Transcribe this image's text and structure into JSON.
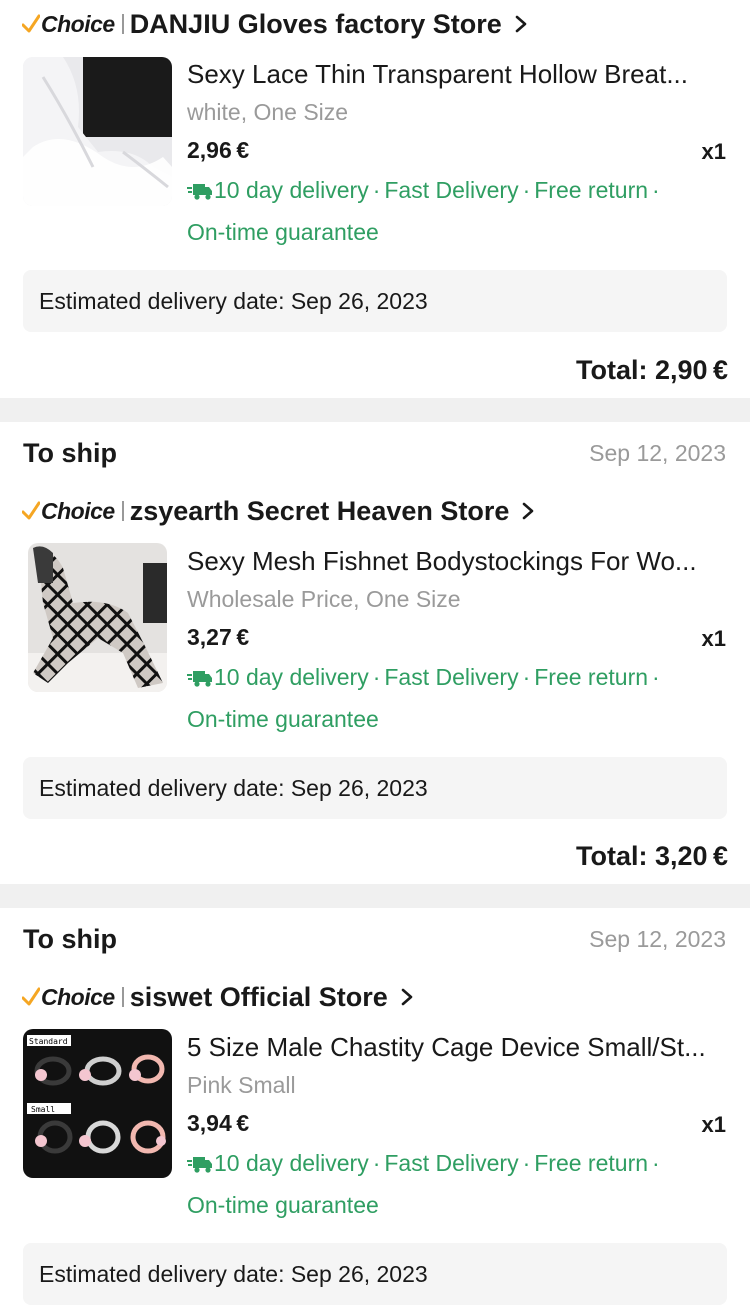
{
  "choice_label": "Choice",
  "colors": {
    "green": "#2f9e62",
    "choice_check": "#f5a623",
    "gap": "#f0f0f0"
  },
  "orders": [
    {
      "status": "",
      "date": "",
      "store": "DANJIU Gloves factory Store",
      "product_title": "Sexy Lace Thin Transparent Hollow Breat...",
      "variant": "white, One Size",
      "price": "2,96 €",
      "qty": "x1",
      "delivery_main": "10 day delivery",
      "delivery_fast": "Fast Delivery",
      "delivery_return": "Free return",
      "delivery_guarantee": "On-time guarantee",
      "estimated": "Estimated delivery date: Sep 26, 2023",
      "total": "Total: 2,90 €",
      "thumb_icon": "white-lace-gloves-image"
    },
    {
      "status": "To ship",
      "date": "Sep 12, 2023",
      "store": "zsyearth Secret Heaven Store",
      "product_title": "Sexy Mesh Fishnet Bodystockings For Wo...",
      "variant": "Wholesale Price, One Size",
      "price": "3,27 €",
      "qty": "x1",
      "delivery_main": "10 day delivery",
      "delivery_fast": "Fast Delivery",
      "delivery_return": "Free return",
      "delivery_guarantee": "On-time guarantee",
      "estimated": "Estimated delivery date: Sep 26, 2023",
      "total": "Total: 3,20 €",
      "thumb_icon": "fishnet-bodystocking-image"
    },
    {
      "status": "To ship",
      "date": "Sep 12, 2023",
      "store": "siswet Official Store",
      "product_title": "5 Size Male Chastity Cage Device Small/St...",
      "variant": "Pink Small",
      "price": "3,94 €",
      "qty": "x1",
      "delivery_main": "10 day delivery",
      "delivery_fast": "Fast Delivery",
      "delivery_return": "Free return",
      "delivery_guarantee": "On-time guarantee",
      "estimated": "Estimated delivery date: Sep 26, 2023",
      "thumb_icon": "chastity-cage-product-image",
      "thumb_labels": [
        "Standard",
        "Small"
      ]
    }
  ]
}
